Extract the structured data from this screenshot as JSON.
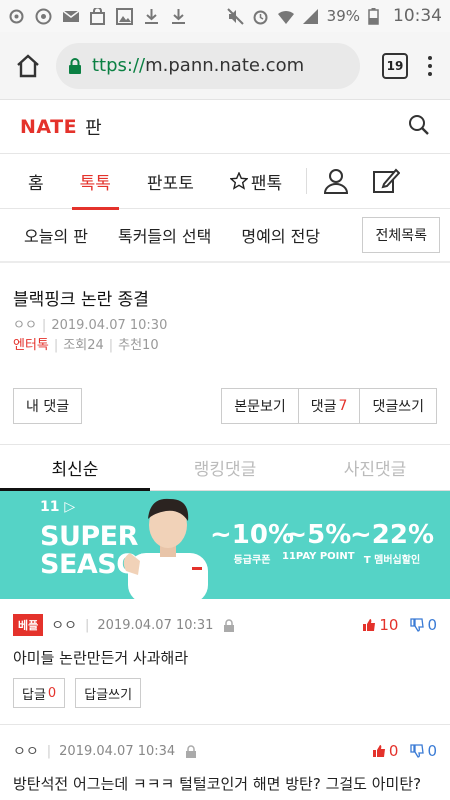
{
  "status": {
    "battery": "39%",
    "time": "10:34"
  },
  "browser": {
    "url_scheme": "ttps://",
    "url_host": "m.pann.nate.com",
    "tab_count": "19"
  },
  "site": {
    "logo": "NATE",
    "logo_sub": "판"
  },
  "nav": {
    "items": [
      "홈",
      "톡톡",
      "판포토",
      "팬톡"
    ],
    "active": "톡톡"
  },
  "subnav": {
    "items": [
      "오늘의 판",
      "톡커들의 선택",
      "명예의 전당"
    ],
    "all_button": "전체목록"
  },
  "post": {
    "title": "블랙핑크 논란 종결",
    "author": "ㅇㅇ",
    "date": "2019.04.07 10:30",
    "category": "엔터톡",
    "views": "조회24",
    "likes": "추천10"
  },
  "actions": {
    "my_comment": "내 댓글",
    "body_view": "본문보기",
    "comments_label": "댓글",
    "comments_count": "7",
    "write_comment": "댓글쓰기"
  },
  "comment_tabs": {
    "items": [
      "최신순",
      "랭킹댓글",
      "사진댓글"
    ],
    "active": "최신순"
  },
  "banner": {
    "brand": "11",
    "headline_1": "SUPER",
    "headline_2": "SEASON",
    "offers": [
      {
        "big": "~10%",
        "small": "등급쿠폰"
      },
      {
        "big": "~5%",
        "small": "11PAY POINT"
      },
      {
        "big": "~22%",
        "small": "T 멤버십할인"
      }
    ],
    "bg_color": "#55d3c6"
  },
  "comments": [
    {
      "badge": "베플",
      "nick": "ㅇㅇ",
      "date": "2019.04.07 10:31",
      "up": "10",
      "down": "0",
      "text": "아미들 논란만든거 사과해라",
      "reply_label": "답글",
      "reply_count": "0",
      "reply_write": "답글쓰기"
    },
    {
      "nick": "ㅇㅇ",
      "date": "2019.04.07 10:34",
      "up": "0",
      "down": "0",
      "text": "방탄석전 어그는데 ㅋㅋㅋ 털털코인거 해면 방탄? 그걸도 아미탄?"
    }
  ],
  "colors": {
    "accent": "#e4322b",
    "link_green": "#0b8043",
    "down_blue": "#3a7bd5"
  }
}
